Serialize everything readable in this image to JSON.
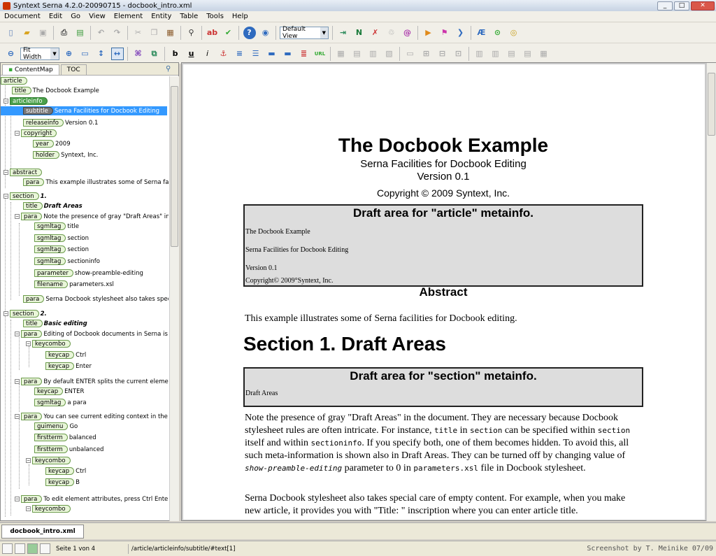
{
  "window": {
    "title": "Syntext Serna 4.2.0-20090715 - docbook_intro.xml",
    "min": "_",
    "max": "□",
    "close": "✕"
  },
  "menu": [
    "Document",
    "Edit",
    "Go",
    "View",
    "Element",
    "Entity",
    "Table",
    "Tools",
    "Help"
  ],
  "toolbar": {
    "view_select": "Default View",
    "zoom_select": "Fit Width"
  },
  "left_panel": {
    "tabs": [
      "ContentMap",
      "TOC"
    ]
  },
  "tree": {
    "n0": {
      "tag": "article"
    },
    "n1": {
      "tag": "title",
      "text": "The Docbook Example"
    },
    "n2": {
      "tag": "articleinfo"
    },
    "n3": {
      "tag": "subtitle",
      "text": "Serna Facilities for Docbook Editing"
    },
    "n4": {
      "tag": "releaseinfo",
      "text": "Version 0.1"
    },
    "n5": {
      "tag": "copyright"
    },
    "n6": {
      "tag": "year",
      "text": "2009"
    },
    "n7": {
      "tag": "holder",
      "text": "Syntext, Inc."
    },
    "n8": {
      "tag": "abstract"
    },
    "n9": {
      "tag": "para",
      "text": "This example illustrates some of Serna facilities"
    },
    "n10": {
      "tag": "section",
      "text": "1."
    },
    "n11": {
      "tag": "title",
      "text": "Draft Areas"
    },
    "n12": {
      "tag": "para",
      "text": "Note the presence of gray \"Draft Areas\" in the"
    },
    "n13": {
      "tag": "sgmltag",
      "text": "title"
    },
    "n14": {
      "tag": "sgmltag",
      "text": "section"
    },
    "n15": {
      "tag": "sgmltag",
      "text": "section"
    },
    "n16": {
      "tag": "sgmltag",
      "text": "sectioninfo"
    },
    "n17": {
      "tag": "parameter",
      "text": "show-preamble-editing"
    },
    "n18": {
      "tag": "filename",
      "text": "parameters.xsl"
    },
    "n19": {
      "tag": "para",
      "text": "Serna Docbook stylesheet also takes special ca"
    },
    "n20": {
      "tag": "section",
      "text": "2."
    },
    "n21": {
      "tag": "title",
      "text": "Basic editing"
    },
    "n22": {
      "tag": "para",
      "text": "Editing of Docbook documents in Serna is quite"
    },
    "n23": {
      "tag": "keycombo"
    },
    "n24": {
      "tag": "keycap",
      "text": "Ctrl"
    },
    "n25": {
      "tag": "keycap",
      "text": "Enter"
    },
    "n26": {
      "tag": "para",
      "text": "By default ENTER splits the current element. Fo"
    },
    "n27": {
      "tag": "keycap",
      "text": "ENTER"
    },
    "n28": {
      "tag": "sgmltag",
      "text": "a para"
    },
    "n29": {
      "tag": "para",
      "text": "You can see current editing context in the botto"
    },
    "n30": {
      "tag": "guimenu",
      "text": "Go"
    },
    "n31": {
      "tag": "firstterm",
      "text": "balanced"
    },
    "n32": {
      "tag": "firstterm",
      "text": "unbalanced"
    },
    "n33": {
      "tag": "keycombo"
    },
    "n34": {
      "tag": "keycap",
      "text": "Ctrl"
    },
    "n35": {
      "tag": "keycap",
      "text": "B"
    },
    "n36": {
      "tag": "para",
      "text": "To edit element attributes, press Ctrl Enter."
    },
    "n37": {
      "tag": "keycombo"
    }
  },
  "doc": {
    "title": "The Docbook Example",
    "subtitle": "Serna Facilities for Docbook Editing",
    "version": "Version 0.1",
    "copyright": "Copyright © 2009 Syntext, Inc.",
    "draft1": {
      "heading": "Draft area for \"article\" metainfo.",
      "lines": [
        "The Docbook Example",
        "Serna Facilities for Docbook Editing",
        "Version 0.1",
        "Copyright© 2009°Syntext, Inc."
      ]
    },
    "abstract_heading": "Abstract",
    "abstract_text": "This example illustrates some of Serna facilities for Docbook editing.",
    "section1": "Section 1. Draft Areas",
    "draft2": {
      "heading": "Draft area for \"section\" metainfo.",
      "line": "Draft Areas"
    },
    "p1": {
      "t1": "Note the presence of gray \"Draft Areas\" in the document. They are necessary because Docbook stylesheet rules are often intricate. For instance, ",
      "c1": "title",
      "t2": " in ",
      "c2": "section",
      "t3": " can be specified within ",
      "c3": "section",
      "t4": " itself and within ",
      "c4": "sectioninfo",
      "t5": ". If you specify both, one of them becomes hidden. To avoid this, all such meta-information is shown also in Draft Areas. They can be turned off by changing value of ",
      "c5": "show-preamble-editing",
      "t6": " parameter to 0 in ",
      "c6": "parameters.xsl",
      "t7": " file in Docbook stylesheet."
    },
    "p2": "Serna Docbook stylesheet also takes special care of empty content. For example, when you make new article, it provides you with \"Title: \" inscription where you can enter article title."
  },
  "doc_tab": "docbook_intro.xml",
  "status": {
    "page": "Seite 1 von 4",
    "path": "/article/articleinfo/subtitle/#text[1]",
    "credit": "Screenshot by T. Meinike 07/09"
  }
}
